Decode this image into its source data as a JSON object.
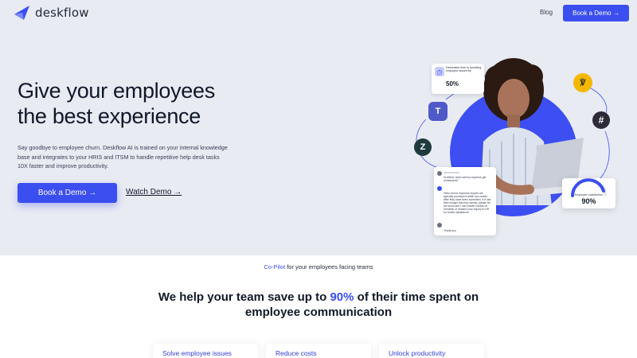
{
  "nav": {
    "brand": "deskflow",
    "blog": "Blog",
    "cta": "Book a Demo →"
  },
  "hero": {
    "title_line1": "Give your employees",
    "title_line2": "the best experience",
    "description": "Say goodbye to employee churn. Deskflow AI is trained on your internal knowledge base and integrates to your HRIS and ITSM to handle repetitive help desk tasks 10X faster and improve productivity.",
    "book_demo": "Book a Demo →",
    "watch_demo": "Watch Demo →"
  },
  "illustration": {
    "time_card_label": "Decreases time to resolving employee issues by",
    "time_card_value": "50%",
    "satisfaction_label": "Employee satisfaction",
    "satisfaction_value": "90%",
    "chat_msg1": "Hi Alfred, when will my expense get reimbursed?",
    "chat_msg2": "Hello Jenna, expense reports are typically processed within two weeks after they have been submitted. If it has been longer than two weeks, please let me know and I can create a ticket on Zendesk or forward your inquiry to HR for further assistance",
    "chat_msg3": "Thank you",
    "icons": [
      "teams-icon",
      "zendesk-icon",
      "ops-icon",
      "slack-icon"
    ]
  },
  "section": {
    "eyebrow_accent": "Co-Pilot",
    "eyebrow_rest": " for your employees facing teams",
    "headline_pre": "We help your team save up to ",
    "headline_accent": "90%",
    "headline_post": " of their time spent on employee communication"
  },
  "features": [
    {
      "label": "Solve employee issues"
    },
    {
      "label": "Reduce costs"
    },
    {
      "label": "Unlock productivity"
    }
  ],
  "colors": {
    "accent": "#3b4ef0",
    "hero_bg": "#e9ebf3"
  }
}
